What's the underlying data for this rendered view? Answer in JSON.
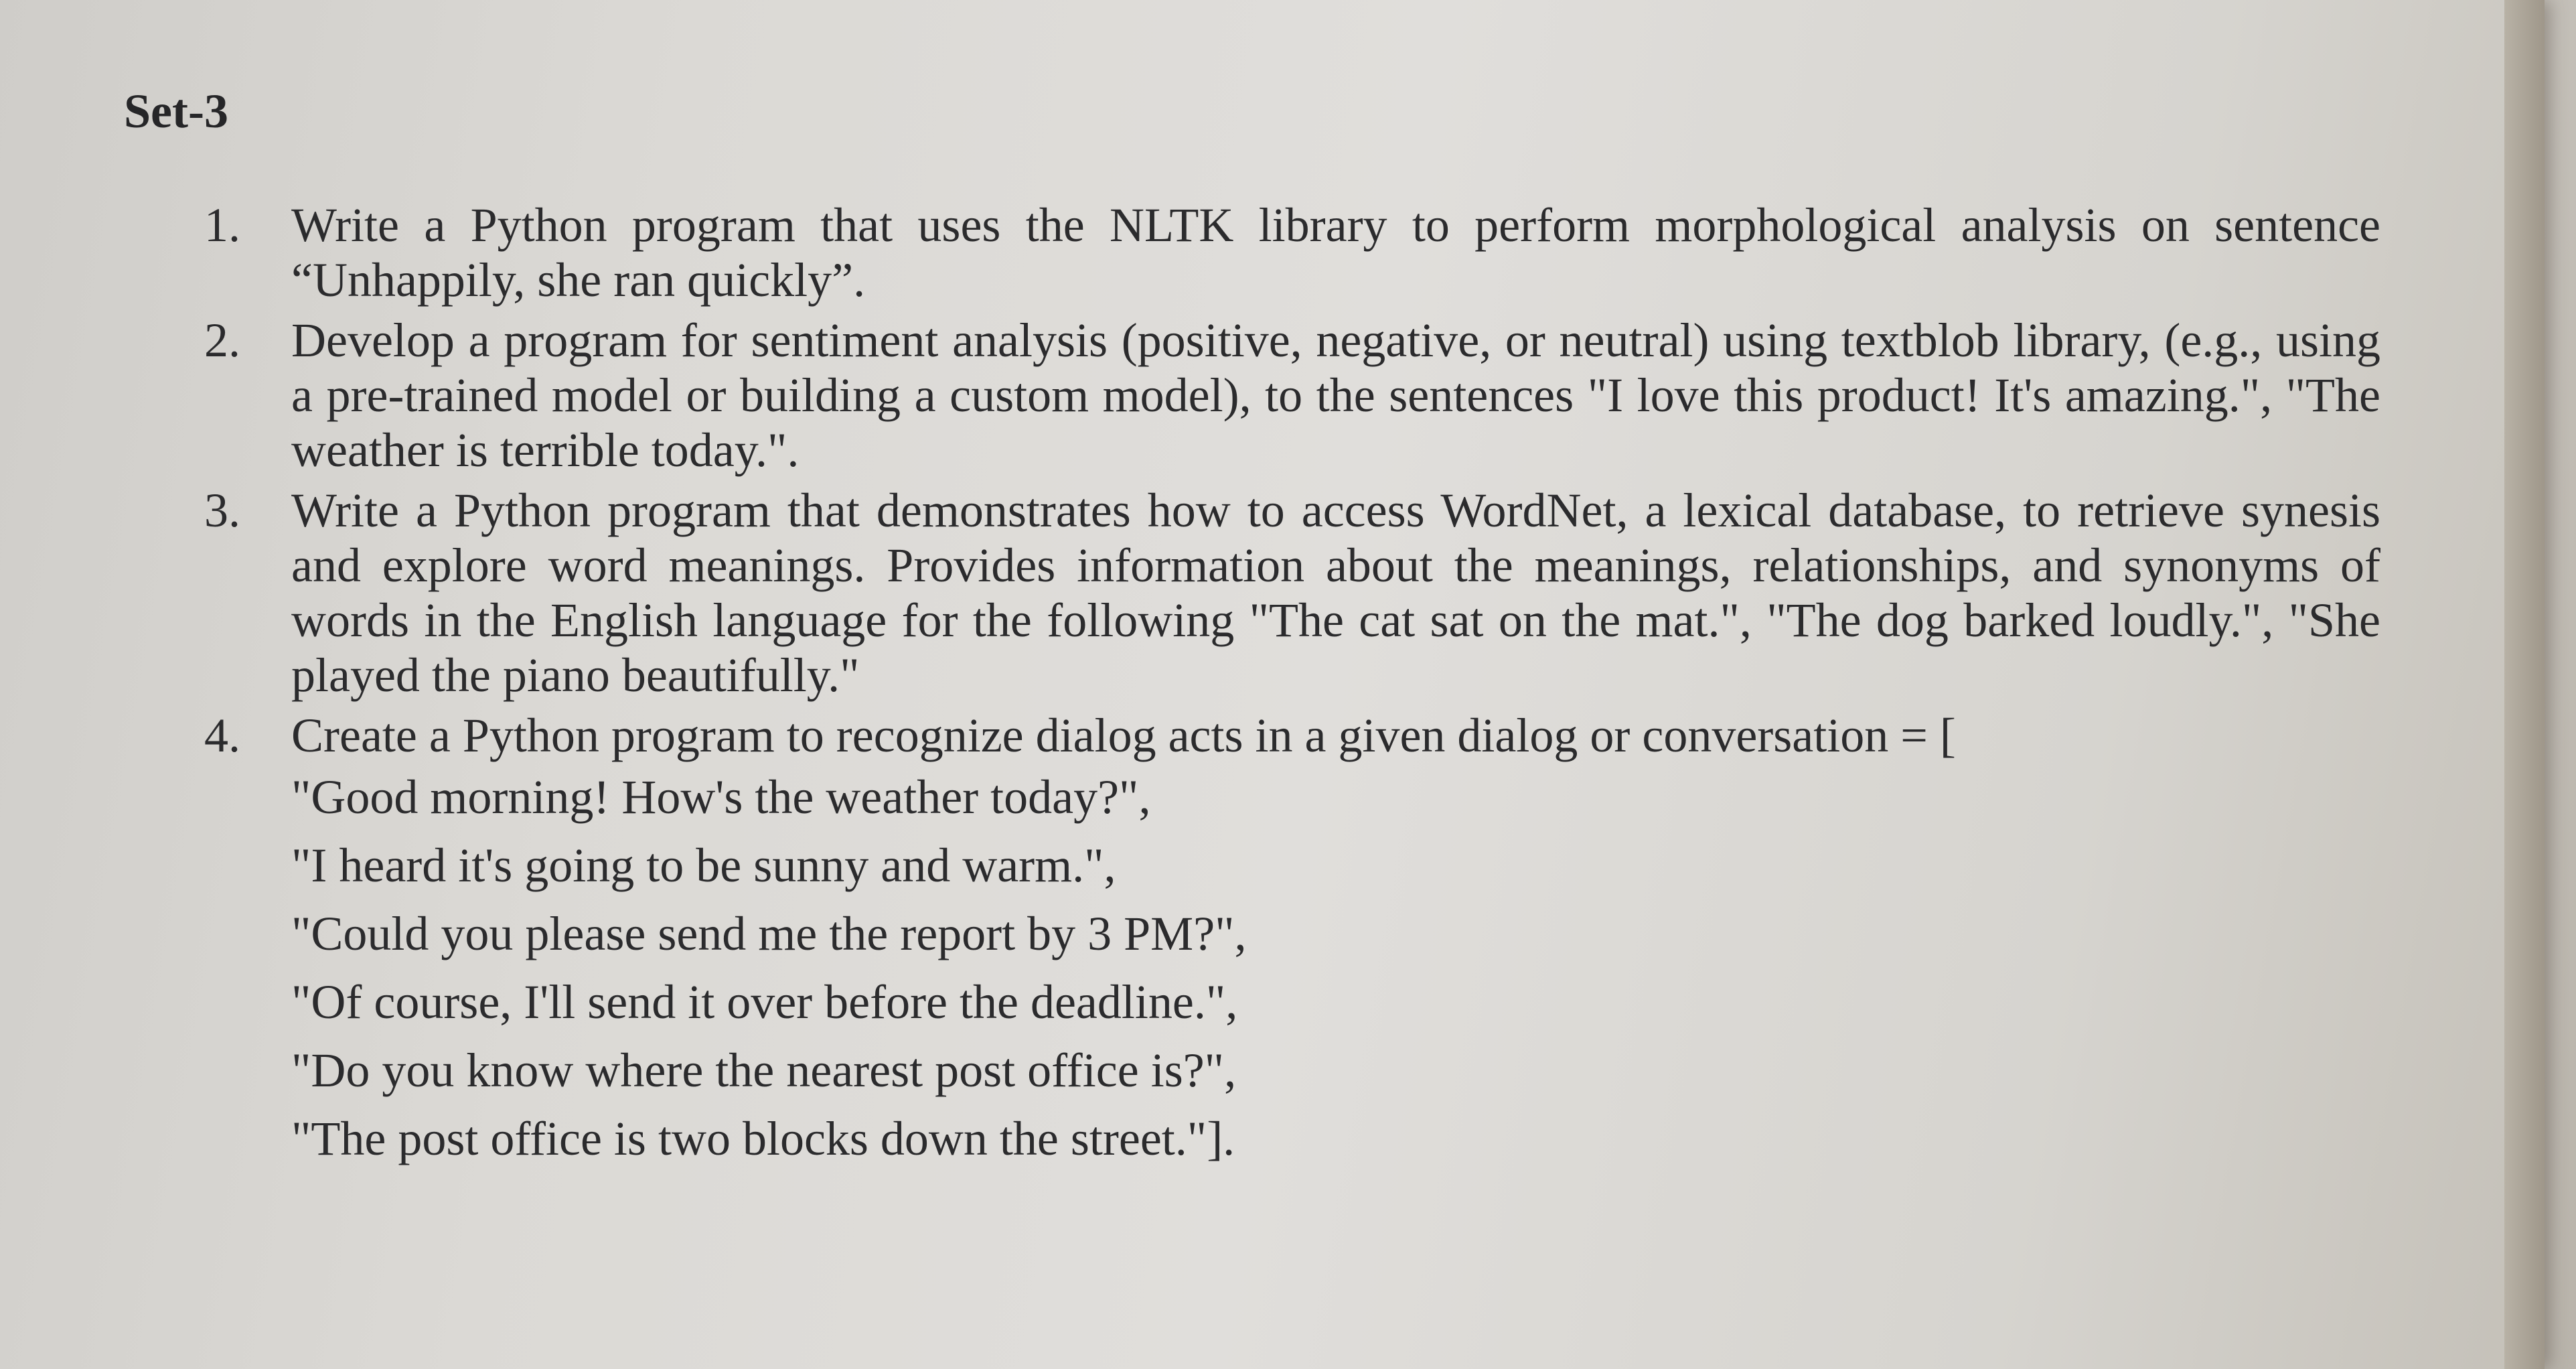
{
  "document": {
    "title": "Set-3",
    "questions": [
      {
        "number": "1.",
        "text": "Write a Python program that uses the NLTK library to perform morphological analysis on sentence “Unhappily, she ran quickly”."
      },
      {
        "number": "2.",
        "text": "Develop a program for sentiment analysis (positive, negative, or neutral) using textblob library, (e.g., using a pre-trained model or building a custom model), to the sentences \"I love this product! It's amazing.\", \"The weather is terrible today.\"."
      },
      {
        "number": "3.",
        "text": "Write a Python program that demonstrates how to access WordNet, a lexical database, to retrieve synesis and explore word meanings. Provides information about the meanings, relationships, and synonyms of words in the English language for the following \"The cat sat on the mat.\", \"The dog barked loudly.\", \"She played the piano beautifully.\""
      },
      {
        "number": "4.",
        "text": "Create a Python program to recognize dialog acts in a given dialog or conversation = [",
        "conversation": [
          "\"Good morning! How's the weather today?\",",
          "\"I heard it's going to be sunny and warm.\",",
          "\"Could you please send me the report by 3 PM?\",",
          "\"Of course, I'll send it over before the deadline.\",",
          "\"Do you know where the nearest post office is?\",",
          "\"The post office is two blocks down the street.\"]."
        ]
      }
    ]
  }
}
